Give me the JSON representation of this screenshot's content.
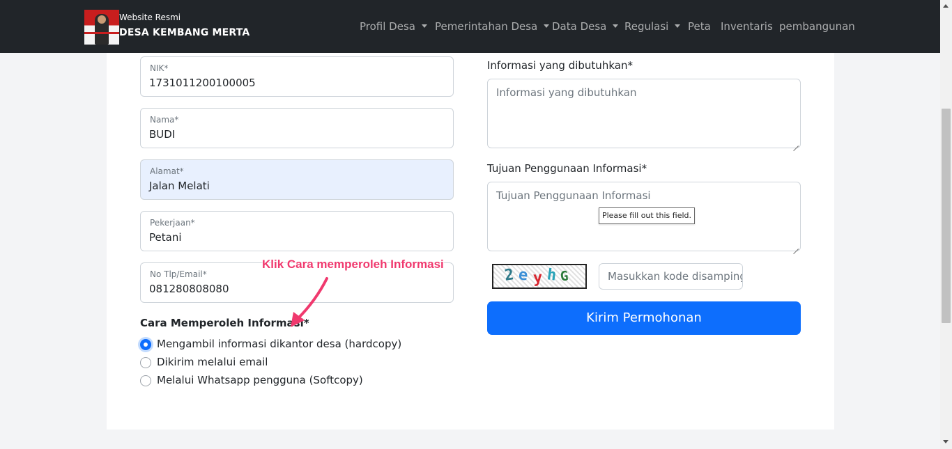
{
  "navbar": {
    "brand_small": "Website Resmi",
    "brand_big": "DESA KEMBANG MERTA",
    "items": [
      {
        "label": "Profil Desa",
        "dropdown": true
      },
      {
        "label": "Pemerintahan Desa",
        "dropdown": true
      },
      {
        "label": "Data Desa",
        "dropdown": true
      },
      {
        "label": "Regulasi",
        "dropdown": true
      },
      {
        "label": "Peta",
        "dropdown": false
      },
      {
        "label": "Inventaris",
        "dropdown": false
      },
      {
        "label": "pembangunan",
        "dropdown": false
      }
    ]
  },
  "form": {
    "fields": [
      {
        "label": "NIK*",
        "value": "1731011200100005"
      },
      {
        "label": "Nama*",
        "value": "BUDI"
      },
      {
        "label": "Alamat*",
        "value": "Jalan Melati"
      },
      {
        "label": "Pekerjaan*",
        "value": "Petani"
      },
      {
        "label": "No Tlp/Email*",
        "value": "081280808080"
      }
    ],
    "cara_title": "Cara Memperoleh Informasi*",
    "options": [
      {
        "label": "Mengambil informasi dikantor desa (hardcopy)",
        "checked": true
      },
      {
        "label": "Dikirim melalui email",
        "checked": false
      },
      {
        "label": "Melalui Whatsapp pengguna (Softcopy)",
        "checked": false
      }
    ],
    "info_label": "Informasi yang dibutuhkan*",
    "info_placeholder": "Informasi yang dibutuhkan",
    "tujuan_label": "Tujuan Penggunaan Informasi*",
    "tujuan_placeholder": "Tujuan Penggunaan Informasi",
    "tooltip": "Please fill out this field.",
    "captcha_text": [
      "2",
      "e",
      "y",
      "h",
      "G"
    ],
    "captcha_colors": [
      "#2f7a8a",
      "#3c8fd6",
      "#d8262f",
      "#2aa3b8",
      "#2c7a3a"
    ],
    "captcha_placeholder": "Masukkan kode disamping",
    "submit_label": "Kirim Permohonan"
  },
  "annotation": {
    "text": "Klik Cara memperoleh Informasi",
    "color": "#f0396e"
  }
}
